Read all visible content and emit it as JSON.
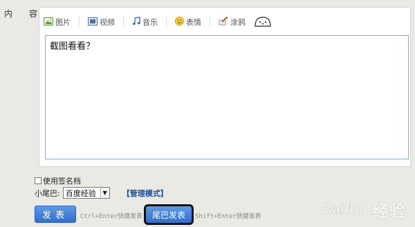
{
  "form": {
    "content_label": "内　容",
    "content_colon": ":"
  },
  "toolbar": {
    "items": [
      {
        "label": "图片",
        "icon": "picture-icon"
      },
      {
        "label": "视频",
        "icon": "video-icon"
      },
      {
        "label": "音乐",
        "icon": "music-icon"
      },
      {
        "label": "表情",
        "icon": "emoji-icon"
      },
      {
        "label": "涂鸦",
        "icon": "doodle-icon"
      }
    ],
    "extra_icon": "face-icon"
  },
  "editor": {
    "value": "截图看看？"
  },
  "signature": {
    "label": "使用签名档",
    "checked": false
  },
  "tail": {
    "label": "小尾巴:",
    "selected": "百度经验",
    "manage_link": "【管理模式】"
  },
  "actions": {
    "publish_label": "发表",
    "publish_hint": "Ctrl+Enter快捷发表",
    "tail_publish_label": "尾巴发表",
    "tail_publish_hint": "Shift+Enter快捷发表"
  },
  "watermark": {
    "text": "经验",
    "brand": "Baidu"
  },
  "colors": {
    "background": "#ebe9e4",
    "button": "#3f7fd9",
    "link": "#1e4f9c"
  }
}
